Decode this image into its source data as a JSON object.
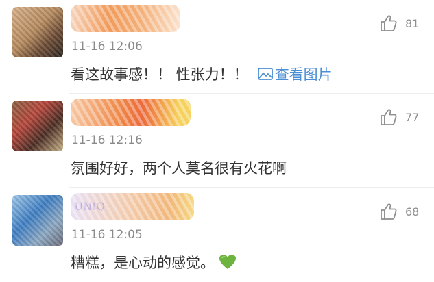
{
  "comments": [
    {
      "username": "",
      "timestamp": "11-16 12:06",
      "text": "看这故事感！！ 性张力！！",
      "view_picture_label": "查看图片",
      "likes": "81"
    },
    {
      "username": "",
      "timestamp": "11-16 12:16",
      "text": "氛围好好，两个人莫名很有火花啊",
      "likes": "77"
    },
    {
      "username": "UNIQ-",
      "timestamp": "11-16 12:05",
      "text": "糟糕，是心动的感觉。",
      "likes": "68",
      "emoji": "green-heart"
    }
  ],
  "colors": {
    "link": "#4a8ed3",
    "text": "#333333",
    "meta": "#8a8a8a",
    "heart": "#6cb33f"
  }
}
